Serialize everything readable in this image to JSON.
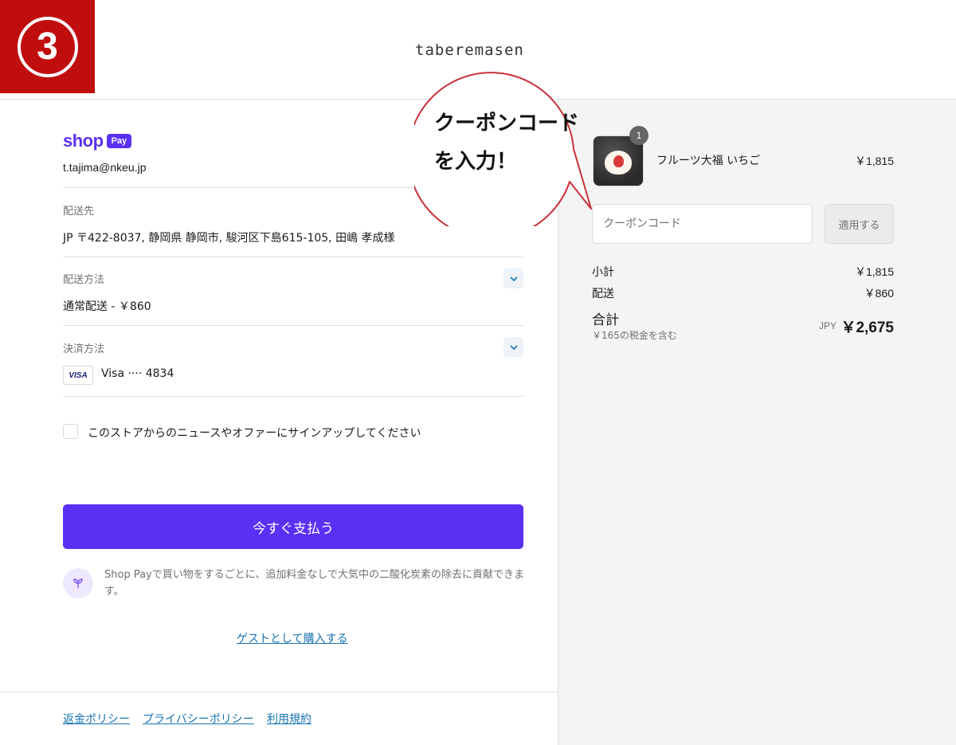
{
  "step": {
    "number": "3",
    "bg_color": "#c00d0d"
  },
  "store": {
    "name": "taberemasen"
  },
  "callout": {
    "line1": "クーポンコード",
    "line2": "を入力！",
    "border_color": "#c9303a"
  },
  "express": {
    "shop_word": "shop",
    "pay_word": "Pay",
    "brand_color": "#5a31f4",
    "email": "t.tajima@nkeu.jp"
  },
  "shipping": {
    "label": "配送先",
    "address": "JP 〒422-8037, 静岡県 静岡市, 駿河区下島615-105, 田嶋 孝成様"
  },
  "delivery": {
    "label": "配送方法",
    "value": "通常配送 - ￥860"
  },
  "payment": {
    "label": "決済方法",
    "card_brand": "VISA",
    "card_text": "Visa ···· 4834"
  },
  "newsletter": {
    "label": "このストアからのニュースやオファーにサインアップしてください",
    "checked": false
  },
  "pay_button": {
    "label": "今すぐ支払う"
  },
  "eco": {
    "text": "Shop Payで買い物をするごとに、追加料金なしで大気中の二酸化炭素の除去に貢献できます。",
    "icon": "sprout-icon"
  },
  "guest_link": "ゲストとして購入する",
  "footer": {
    "links": [
      "返金ポリシー",
      "プライバシーポリシー",
      "利用規約"
    ]
  },
  "cart": {
    "items": [
      {
        "name": "フルーツ大福 いちご",
        "price": "￥1,815",
        "quantity": "1"
      }
    ]
  },
  "coupon": {
    "placeholder": "クーポンコード",
    "apply_label": "適用する"
  },
  "totals": {
    "subtotal_label": "小計",
    "subtotal_value": "￥1,815",
    "shipping_label": "配送",
    "shipping_value": "￥860",
    "total_label": "合計",
    "tax_note": "￥165の税金を含む",
    "currency": "JPY",
    "total_value": "￥2,675"
  }
}
